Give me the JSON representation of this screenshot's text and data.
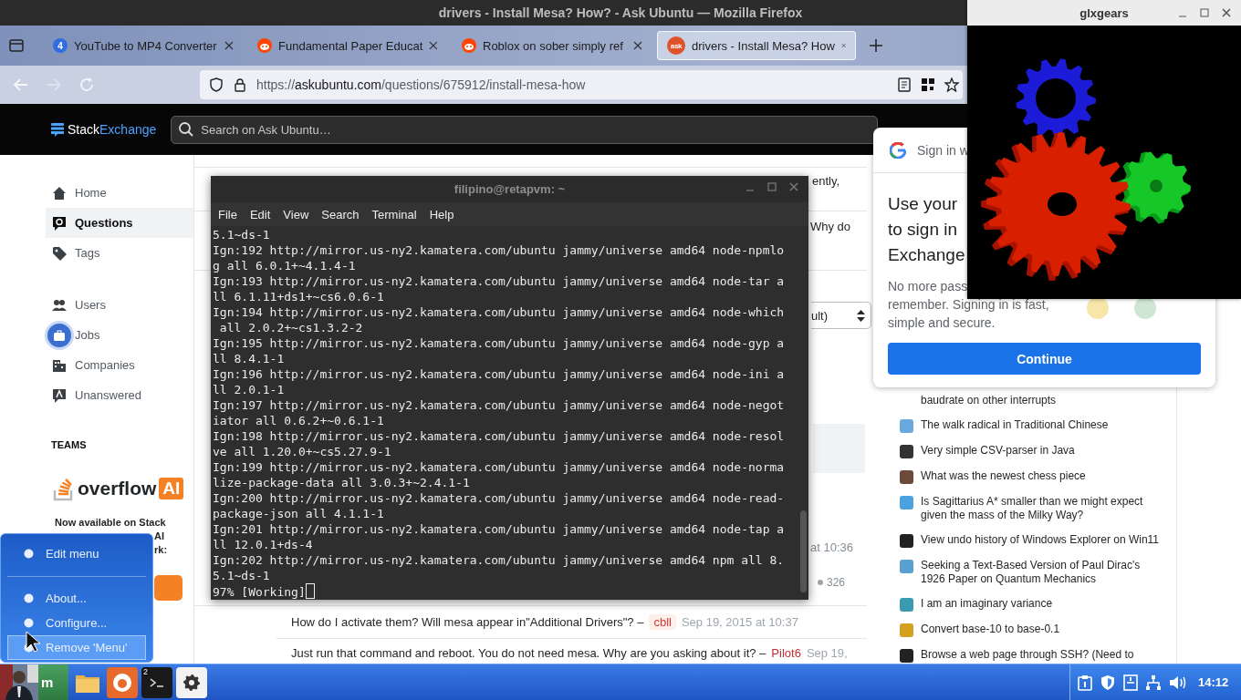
{
  "firefox": {
    "title": "drivers - Install Mesa? How? - Ask Ubuntu — Mozilla Firefox",
    "tabs": [
      {
        "kind": "number",
        "favicon_text": "4",
        "label": "YouTube to MP4 Converter",
        "selected": false
      },
      {
        "kind": "alien",
        "label": "Fundamental Paper Educat",
        "selected": false
      },
      {
        "kind": "alien",
        "label": "Roblox on sober simply ref",
        "selected": false
      },
      {
        "kind": "speech",
        "favicon_text": "ask",
        "label": "drivers - Install Mesa? How",
        "selected": true
      }
    ],
    "url": {
      "scheme": "https://",
      "host": "askubuntu.com",
      "path": "/questions/675912/install-mesa-how"
    }
  },
  "site_header": {
    "logo_first": "Stack",
    "logo_second": "Exchange",
    "search_placeholder": "Search on Ask Ubuntu…"
  },
  "left_nav": {
    "items": [
      {
        "label": "Home",
        "selected": false,
        "highlighted": false
      },
      {
        "label": "Questions",
        "selected": true,
        "highlighted": false
      },
      {
        "label": "Tags",
        "selected": false,
        "highlighted": false
      },
      {
        "label": "Users",
        "selected": false,
        "highlighted": false
      },
      {
        "label": "Jobs",
        "selected": false,
        "highlighted": true
      },
      {
        "label": "Companies",
        "selected": false,
        "highlighted": false
      },
      {
        "label": "Unanswered",
        "selected": false,
        "highlighted": false
      }
    ],
    "teams_heading": "TEAMS",
    "logo_word": "overflow",
    "logo_badge": "AI",
    "promo_line": "Now available on Stack",
    "promo_fragments": [
      "AI",
      "rk:"
    ]
  },
  "question": {
    "fragments": [
      "ently,",
      "Why do"
    ],
    "sort_select": "ult)",
    "answer_time": "at 10:36",
    "score": "326",
    "comments": [
      {
        "text": "How do I activate them? Will mesa appear in\"Additional Drivers\"? –",
        "user": "cbll",
        "op": true,
        "date": "Sep 19, 2015 at 10:37"
      },
      {
        "text": "Just run that command and reboot. You do not need mesa. Why are you asking about it? –",
        "user": "Pilot6",
        "op": false,
        "date": "Sep 19,"
      }
    ]
  },
  "hot_questions": [
    "baudrate on other interrupts",
    "The walk radical in Traditional Chinese",
    "Very simple CSV-parser in Java",
    "What was the newest chess piece",
    "Is Sagittarius A* smaller than we might expect given the mass of the Milky Way?",
    "View undo history of Windows Explorer on Win11",
    "Seeking a Text-Based Version of Paul Dirac's 1926 Paper on Quantum Mechanics",
    "I am an imaginary variance",
    "Convert base-10 to base-0.1",
    "Browse a web page through SSH? (Need to"
  ],
  "sign_in_popup": {
    "header": "Sign in w",
    "heading_lines": [
      "Use your",
      "to sign in",
      "Exchange"
    ],
    "body_lines": [
      "No more pass",
      "remember. Signing in is fast,",
      "simple and secure."
    ],
    "button": "Continue"
  },
  "terminal": {
    "title": "filipino@retapvm: ~",
    "menu": [
      "File",
      "Edit",
      "View",
      "Search",
      "Terminal",
      "Help"
    ],
    "lines": [
      "5.1~ds-1",
      "Ign:192 http://mirror.us-ny2.kamatera.com/ubuntu jammy/universe amd64 node-npmlo",
      "g all 6.0.1+~4.1.4-1",
      "Ign:193 http://mirror.us-ny2.kamatera.com/ubuntu jammy/universe amd64 node-tar a",
      "ll 6.1.11+ds1+~cs6.0.6-1",
      "Ign:194 http://mirror.us-ny2.kamatera.com/ubuntu jammy/universe amd64 node-which",
      " all 2.0.2+~cs1.3.2-2",
      "Ign:195 http://mirror.us-ny2.kamatera.com/ubuntu jammy/universe amd64 node-gyp a",
      "ll 8.4.1-1",
      "Ign:196 http://mirror.us-ny2.kamatera.com/ubuntu jammy/universe amd64 node-ini a",
      "ll 2.0.1-1",
      "Ign:197 http://mirror.us-ny2.kamatera.com/ubuntu jammy/universe amd64 node-negot",
      "iator all 0.6.2+~0.6.1-1",
      "Ign:198 http://mirror.us-ny2.kamatera.com/ubuntu jammy/universe amd64 node-resol",
      "ve all 1.20.0+~cs5.27.9-1",
      "Ign:199 http://mirror.us-ny2.kamatera.com/ubuntu jammy/universe amd64 node-norma",
      "lize-package-data all 3.0.3+~2.4.1-1",
      "Ign:200 http://mirror.us-ny2.kamatera.com/ubuntu jammy/universe amd64 node-read-",
      "package-json all 4.1.1-1",
      "Ign:201 http://mirror.us-ny2.kamatera.com/ubuntu jammy/universe amd64 node-tap a",
      "ll 12.0.1+ds-4",
      "Ign:202 http://mirror.us-ny2.kamatera.com/ubuntu jammy/universe amd64 npm all 8.",
      "5.1~ds-1"
    ],
    "prompt": "97% [Working]"
  },
  "glxgears": {
    "title": "glxgears"
  },
  "start_menu": {
    "items": [
      {
        "kind": "item",
        "label": "Edit menu",
        "selected": false
      },
      {
        "kind": "separator"
      },
      {
        "kind": "item",
        "label": "About...",
        "selected": false
      },
      {
        "kind": "item",
        "label": "Configure...",
        "selected": false
      },
      {
        "kind": "item",
        "label": "Remove 'Menu'",
        "selected": true
      }
    ]
  },
  "taskbar": {
    "start_label": "m",
    "terminal_badge": "2",
    "clock": "14:12"
  }
}
